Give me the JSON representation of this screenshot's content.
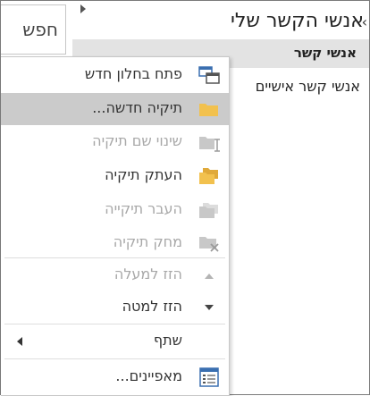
{
  "search": {
    "label": "חפש"
  },
  "pane": {
    "title": "אנשי הקשר שלי",
    "section_header": "אנשי קשר",
    "folder_item": "אנשי קשר אישיים"
  },
  "context_menu": {
    "items": [
      {
        "label": "פתח בחלון חדש",
        "icon": "open-in-new-window-icon",
        "enabled": true
      },
      {
        "label": "תיקיה חדשה...",
        "icon": "new-folder-icon",
        "enabled": true,
        "highlighted": true
      },
      {
        "label": "שינוי שם תיקיה",
        "icon": "rename-folder-icon",
        "enabled": false
      },
      {
        "label": "העתק תיקיה",
        "icon": "copy-folder-icon",
        "enabled": true
      },
      {
        "label": "העבר תיקייה",
        "icon": "move-folder-icon",
        "enabled": false
      },
      {
        "label": "מחק תיקיה",
        "icon": "delete-folder-icon",
        "enabled": false
      },
      {
        "label": "הזז למעלה",
        "icon": "move-up-icon",
        "enabled": false
      },
      {
        "label": "הזז למטה",
        "icon": "move-down-icon",
        "enabled": true
      },
      {
        "label": "שתף",
        "icon": "share-submenu-arrow-icon",
        "enabled": true
      },
      {
        "label": "מאפיינים...",
        "icon": "properties-icon",
        "enabled": true
      }
    ]
  },
  "colors": {
    "folder_yellow": "#f2c14e",
    "highlight": "#cbcbcb",
    "disabled_text": "#a8a8a8",
    "header_gray": "#e3e3e3",
    "icon_blue": "#3a6fb0"
  }
}
